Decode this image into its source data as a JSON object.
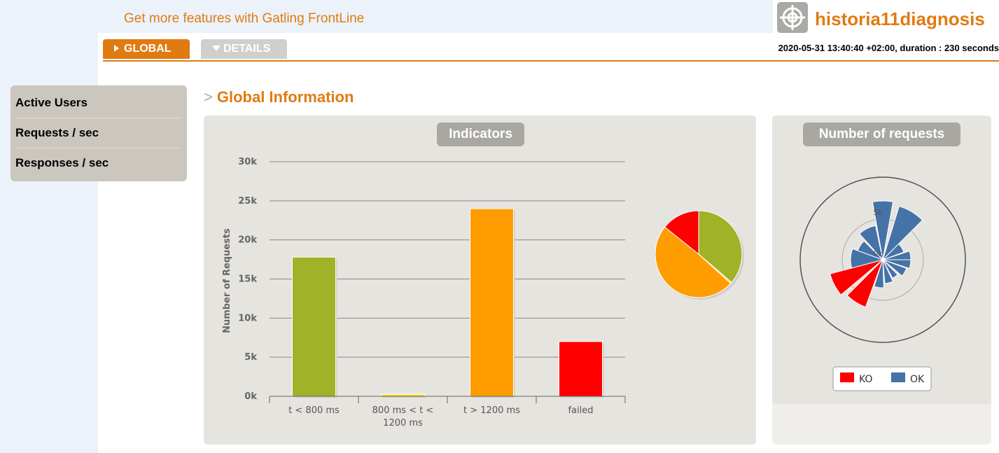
{
  "header": {
    "frontline_link": "Get more features with Gatling FrontLine",
    "app_title": "historia11diagnosis",
    "logo_icon": "crosshair-target-icon"
  },
  "tabs": {
    "global_label": "GLOBAL",
    "details_label": "DETAILS"
  },
  "run_info": "2020-05-31 13:40:40 +02:00, duration : 230 seconds",
  "sidebar": {
    "items": [
      {
        "label": "Active Users"
      },
      {
        "label": "Requests / sec"
      },
      {
        "label": "Responses / sec"
      }
    ]
  },
  "section": {
    "prefix": ">",
    "title": "Global Information"
  },
  "indicators": {
    "title": "Indicators"
  },
  "number_of_requests": {
    "title": "Number of requests",
    "legend": [
      {
        "label": "KO",
        "color": "#ff0000"
      },
      {
        "label": "OK",
        "color": "#4572a7"
      }
    ],
    "radial_ticks": [
      "5k",
      "0k"
    ]
  },
  "chart_data": [
    {
      "type": "bar",
      "title": "Indicators",
      "categories": [
        "t < 800 ms",
        "800 ms < t < 1200 ms",
        "t > 1200 ms",
        "failed"
      ],
      "category_lines": [
        [
          "t < 800 ms"
        ],
        [
          "800 ms < t <",
          "1200 ms"
        ],
        [
          "t > 1200 ms"
        ],
        [
          "failed"
        ]
      ],
      "values": [
        17800,
        250,
        24000,
        7000
      ],
      "colors": [
        "#a0b228",
        "#ffdd00",
        "#ff9d00",
        "#ff0000"
      ],
      "ylabel": "Number of Requests",
      "ylim": [
        0,
        30000
      ],
      "yticks": [
        "0k",
        "5k",
        "10k",
        "15k",
        "20k",
        "25k",
        "30k"
      ],
      "grid": true
    },
    {
      "type": "pie",
      "labels": [
        "t < 800 ms",
        "800 ms < t < 1200 ms",
        "t > 1200 ms",
        "failed"
      ],
      "values": [
        17800,
        250,
        24000,
        7000
      ],
      "colors": [
        "#a0b228",
        "#ffdd00",
        "#ff9d00",
        "#ff0000"
      ]
    }
  ]
}
